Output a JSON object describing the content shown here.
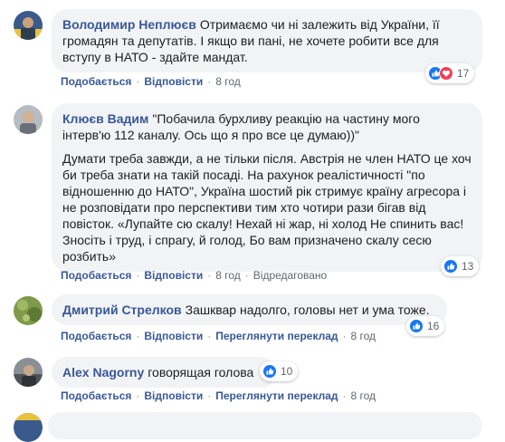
{
  "comments": [
    {
      "author": "Володимир Неплюєв",
      "text": "Отримаємо чи ні залежить від України, її громадян та депутатів. І якщо ви пані, не хочете робити все для вступу в НАТО - здайте мандат.",
      "like_label": "Подобається",
      "reply_label": "Відповісти",
      "time": "8 год",
      "reaction_count": "17",
      "reaction_icons": [
        "like-icon",
        "love-icon"
      ]
    },
    {
      "author": "Клюєв Вадим",
      "text": "\"Побачила бурхливу реакцію на частину мого інтерв'ю 112 каналу. Ось що я про все це думаю))\"",
      "text2": "Думати треба завжди, а не тільки після. Австрія не член НАТО це хоч би треба знати на такій посаді. На рахунок реалістичності \"по відношенню до НАТО\", Україна шостий рік стримує країну агресора і не розповідати про перспективи тим хто чотири рази бігав від повісток. «Лупайте сю скалу! Нехай ні жар, ні холод Не спинить вас! Зносіть і труд, і спрагу, й голод, Бо вам призначено скалу сесю розбить»",
      "like_label": "Подобається",
      "reply_label": "Відповісти",
      "time": "8 год",
      "edited_label": "Відредаговано",
      "reaction_count": "13",
      "reaction_icons": [
        "like-icon"
      ]
    },
    {
      "author": "Дмитрий Стрелков",
      "text": "Зашквар надолго, головы нет и ума тоже.",
      "like_label": "Подобається",
      "reply_label": "Відповісти",
      "translate_label": "Переглянути переклад",
      "time": "8 год",
      "reaction_count": "16",
      "reaction_icons": [
        "like-icon"
      ]
    },
    {
      "author": "Alex Nagorny",
      "text": "говорящая голова",
      "like_label": "Подобається",
      "reply_label": "Відповісти",
      "translate_label": "Переглянути переклад",
      "time": "8 год",
      "reaction_count": "10",
      "reaction_icons": [
        "like-icon"
      ]
    }
  ],
  "colors": {
    "author": "#385898",
    "bubble": "#f2f3f5",
    "meta": "#606770",
    "like": "#1877f2",
    "love": "#f33e58"
  }
}
